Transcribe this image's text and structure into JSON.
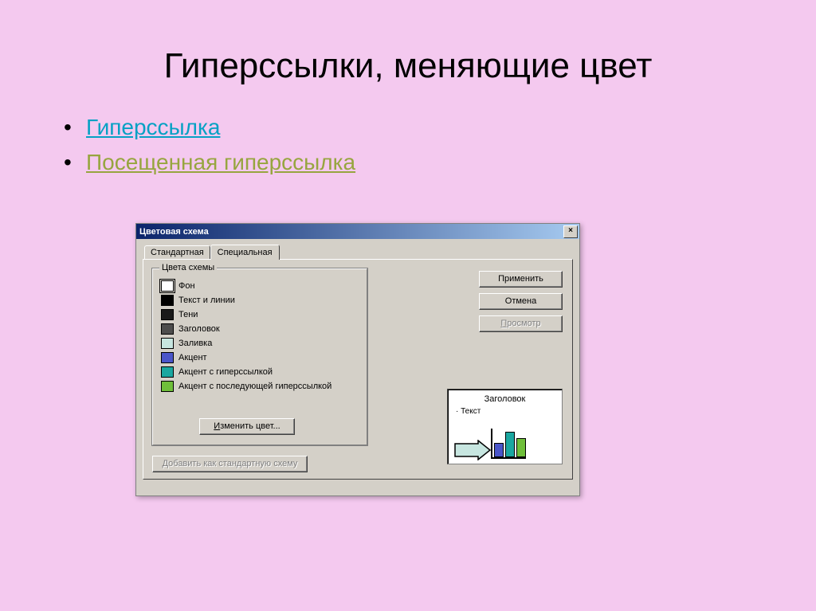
{
  "slide": {
    "title": "Гиперссылки, меняющие цвет",
    "bullet1": "Гиперссылка",
    "bullet2": "Посещенная гиперссылка"
  },
  "dialog": {
    "title": "Цветовая схема",
    "tab_standard": "Стандартная",
    "tab_custom": "Специальная",
    "group_label": "Цвета схемы",
    "colors": [
      {
        "label": "Фон",
        "hex": "#ffffff"
      },
      {
        "label": "Текст и линии",
        "hex": "#000000"
      },
      {
        "label": "Тени",
        "hex": "#1a1a1a"
      },
      {
        "label": "Заголовок",
        "hex": "#4d4d4d"
      },
      {
        "label": "Заливка",
        "hex": "#c7e6e0"
      },
      {
        "label": "Акцент",
        "hex": "#4a55c9"
      },
      {
        "label": "Акцент с гиперссылкой",
        "hex": "#1aa7a0"
      },
      {
        "label": "Акцент с последующей гиперссылкой",
        "hex": "#6fbf3a"
      }
    ],
    "btn_change": "Изменить цвет...",
    "btn_apply": "Применить",
    "btn_cancel": "Отмена",
    "btn_preview": "Просмотр",
    "btn_addstd": "Добавить как стандартную схему",
    "preview": {
      "title": "Заголовок",
      "text": "Текст"
    }
  }
}
